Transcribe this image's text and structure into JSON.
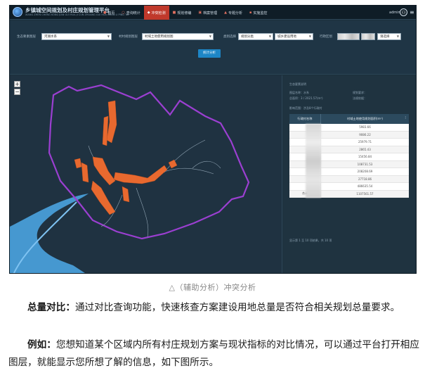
{
  "app": {
    "title": "乡镇城空间规划及村庄规划管理平台",
    "subtitle": "XIANG ZHEN CHENG KONG JIAN GUI HUA JI CUN ZHUANG GUI HUA GUAN LI PING TAI"
  },
  "nav": {
    "items": [
      {
        "label": "首页",
        "icon": "home-icon",
        "active": false
      },
      {
        "label": "查询统计",
        "icon": "search-icon",
        "active": false
      },
      {
        "label": "冲突检测",
        "icon": "shield-icon",
        "active": true
      },
      {
        "label": "规划修编",
        "icon": "edit-icon",
        "active": false
      },
      {
        "label": "档案管理",
        "icon": "folder-icon",
        "active": false
      },
      {
        "label": "专题分析",
        "icon": "chart-icon",
        "active": false
      },
      {
        "label": "实施监控",
        "icon": "monitor-icon",
        "active": false
      }
    ],
    "user": "admin"
  },
  "filters": {
    "layer1_label": "生态要素图层",
    "layer1_value": "河湖水系",
    "layer2_label": "村村规划图层",
    "layer2_value": "村域土地使用规划图",
    "type_label": "类别选择",
    "type_value1": "规划分类",
    "type_value2": "城乡建设用地",
    "region_label": "行政区划",
    "region_value": "请选择",
    "stat_button": "统计分析"
  },
  "panel": {
    "title": "生态要素说明",
    "layer_label": "图层名称：",
    "layer_value": "水系",
    "area_label": "总面积：",
    "area_value": "3 / 2021.57(m²)",
    "affect_label": "影响范围：",
    "affect_value": "涉及8个行政村",
    "req_label": "规划要求：",
    "req2_label": "法规依据：",
    "col1": "行政村名称",
    "col2": "村域土地使用规划面积(m²)",
    "rows": [
      "5983.66",
      "9086.22",
      "25979.71",
      "2865.43",
      "15456.84",
      "108731.53",
      "208208.69",
      "27718.86",
      "486635.54"
    ],
    "total_label": "合计",
    "total_value": "1107561.57",
    "pager": "显示第 1 至 10 项结果，共 10 项"
  },
  "caption": "△（辅助分析）冲突分析",
  "paragraphs": {
    "p1_head": "总量对比：",
    "p1_body": "通过对比查询功能，快速核查方案建设用地总量是否符合相关规划总量要求。",
    "p2_head": "例如：",
    "p2_body": "您想知道某个区域内所有村庄规划方案与现状指标的对比情况，可以通过平台打开相应图层，就能显示您所想了解的信息，如下图所示。"
  },
  "colors": {
    "active_tab": "#c0392b",
    "boundary": "#9b3fd1",
    "river": "#4aa3e0",
    "planning_area": "#e8692f",
    "button": "#1d86c6"
  }
}
